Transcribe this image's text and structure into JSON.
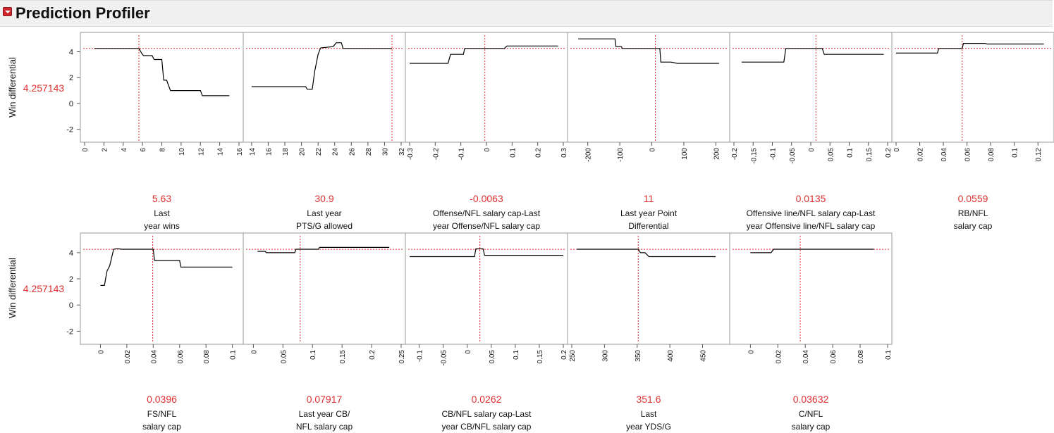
{
  "profiler": {
    "title": "Prediction Profiler",
    "response_label": "Win differential",
    "response_value": "4.257143",
    "colors": {
      "curve": "#000000",
      "crosshair": "#e03030",
      "value_text": "#e03030",
      "frame": "#999999"
    }
  },
  "chart_data": [
    {
      "type": "line",
      "title": "",
      "ylabel": "Win differential",
      "xlabel": "Last year wins",
      "current_x": "5.63",
      "current_x_num": 5.63,
      "current_y": 4.257143,
      "xlim": [
        0,
        16
      ],
      "ylim": [
        -3,
        5.5
      ],
      "xticks": [
        0,
        2,
        4,
        6,
        8,
        10,
        12,
        14,
        16
      ],
      "xtick_labels": [
        "0",
        "2",
        "4",
        "6",
        "8",
        "10",
        "12",
        "14",
        "16"
      ],
      "yticks": [
        -2,
        0,
        2,
        4
      ],
      "ytick_labels": [
        "-2",
        "0",
        "2",
        "4"
      ],
      "x": [
        1,
        5.63,
        5.9,
        6.1,
        7,
        7.2,
        8,
        8.2,
        8.5,
        8.9,
        9.2,
        12,
        12.2,
        15
      ],
      "y": [
        4.26,
        4.26,
        3.9,
        3.7,
        3.7,
        3.4,
        3.4,
        1.8,
        1.8,
        1.0,
        1.0,
        1.0,
        0.6,
        0.6
      ]
    },
    {
      "type": "line",
      "title": "",
      "ylabel": "Win differential",
      "xlabel": "Last year PTS/G allowed",
      "current_x": "30.9",
      "current_x_num": 30.9,
      "current_y": 4.257143,
      "xlim": [
        13.5,
        32
      ],
      "ylim": [
        -3,
        5.5
      ],
      "xticks": [
        14,
        16,
        18,
        20,
        22,
        24,
        26,
        28,
        30,
        32
      ],
      "xtick_labels": [
        "14",
        "16",
        "18",
        "20",
        "22",
        "24",
        "26",
        "28",
        "30",
        "32"
      ],
      "yticks": [
        -2,
        0,
        2,
        4
      ],
      "ytick_labels": [
        "-2",
        "0",
        "2",
        "4"
      ],
      "x": [
        14,
        20.5,
        20.7,
        21.3,
        21.6,
        22,
        22.3,
        23.8,
        24.2,
        24.8,
        25,
        30.9
      ],
      "y": [
        1.3,
        1.3,
        1.1,
        1.1,
        2.5,
        3.8,
        4.3,
        4.4,
        4.7,
        4.7,
        4.26,
        4.26
      ]
    },
    {
      "type": "line",
      "title": "",
      "ylabel": "Win differential",
      "xlabel": "Offense/NFL salary cap-Last year Offense/NFL salary cap",
      "current_x": "-0.0063",
      "current_x_num": -0.0063,
      "current_y": 4.257143,
      "xlim": [
        -0.3,
        0.3
      ],
      "ylim": [
        -3,
        5.5
      ],
      "xticks": [
        -0.3,
        -0.2,
        -0.1,
        0,
        0.1,
        0.2,
        0.3
      ],
      "xtick_labels": [
        "-0.3",
        "-0.2",
        "-0.1",
        "0",
        "0.1",
        "0.2",
        "0.3"
      ],
      "yticks": [
        -2,
        0,
        2,
        4
      ],
      "ytick_labels": [
        "-2",
        "0",
        "2",
        "4"
      ],
      "x": [
        -0.3,
        -0.15,
        -0.14,
        -0.09,
        -0.085,
        0.07,
        0.08,
        0.28
      ],
      "y": [
        3.1,
        3.1,
        3.8,
        3.8,
        4.26,
        4.26,
        4.45,
        4.45
      ]
    },
    {
      "type": "line",
      "title": "",
      "ylabel": "Win differential",
      "xlabel": "Last year Point Differential",
      "current_x": "11",
      "current_x_num": 11,
      "current_y": 4.257143,
      "xlim": [
        -250,
        230
      ],
      "ylim": [
        -3,
        5.5
      ],
      "xticks": [
        -200,
        -100,
        0,
        100,
        200
      ],
      "xtick_labels": [
        "-200",
        "-100",
        "0",
        "100",
        "200"
      ],
      "yticks": [
        -2,
        0,
        2,
        4
      ],
      "ytick_labels": [
        "-2",
        "0",
        "2",
        "4"
      ],
      "x": [
        -230,
        -115,
        -112,
        -95,
        -92,
        11,
        25,
        28,
        60,
        80,
        85,
        100,
        210
      ],
      "y": [
        5.0,
        5.0,
        4.4,
        4.4,
        4.26,
        4.26,
        4.26,
        3.2,
        3.2,
        3.1,
        3.1,
        3.1,
        3.1
      ]
    },
    {
      "type": "line",
      "title": "",
      "ylabel": "Win differential",
      "xlabel": "Offensive line/NFL salary cap-Last year Offensive line/NFL salary cap",
      "current_x": "0.0135",
      "current_x_num": 0.0135,
      "current_y": 4.257143,
      "xlim": [
        -0.2,
        0.2
      ],
      "ylim": [
        -3,
        5.5
      ],
      "xticks": [
        -0.2,
        -0.15,
        -0.1,
        -0.05,
        0,
        0.05,
        0.1,
        0.15,
        0.2
      ],
      "xtick_labels": [
        "-0.2",
        "-0.15",
        "-0.1",
        "-0.05",
        "0",
        "0.05",
        "0.1",
        "0.15",
        "0.2"
      ],
      "yticks": [
        -2,
        0,
        2,
        4
      ],
      "ytick_labels": [
        "-2",
        "0",
        "2",
        "4"
      ],
      "x": [
        -0.18,
        -0.07,
        -0.065,
        0.0135,
        0.03,
        0.035,
        0.19
      ],
      "y": [
        3.2,
        3.2,
        4.26,
        4.26,
        4.26,
        3.8,
        3.8
      ]
    },
    {
      "type": "line",
      "title": "",
      "ylabel": "Win differential",
      "xlabel": "RB/NFL salary cap",
      "current_x": "0.0559",
      "current_x_num": 0.0559,
      "current_y": 4.257143,
      "xlim": [
        0,
        0.13
      ],
      "ylim": [
        -3,
        5.5
      ],
      "xticks": [
        0,
        0.02,
        0.04,
        0.06,
        0.08,
        0.1,
        0.12
      ],
      "xtick_labels": [
        "0",
        "0.02",
        "0.04",
        "0.06",
        "0.08",
        "0.1",
        "0.12"
      ],
      "yticks": [
        -2,
        0,
        2,
        4
      ],
      "ytick_labels": [
        "-2",
        "0",
        "2",
        "4"
      ],
      "x": [
        0,
        0.035,
        0.036,
        0.045,
        0.047,
        0.0559,
        0.057,
        0.075,
        0.077,
        0.125
      ],
      "y": [
        3.9,
        3.9,
        4.26,
        4.26,
        4.26,
        4.26,
        4.65,
        4.65,
        4.6,
        4.6
      ]
    },
    {
      "type": "line",
      "title": "",
      "ylabel": "Win differential",
      "xlabel": "FS/NFL salary cap",
      "current_x": "0.0396",
      "current_x_num": 0.0396,
      "current_y": 4.257143,
      "xlim": [
        -0.012,
        0.105
      ],
      "ylim": [
        -3,
        5.5
      ],
      "xticks": [
        0,
        0.02,
        0.04,
        0.06,
        0.08,
        0.1
      ],
      "xtick_labels": [
        "0",
        "0.02",
        "0.04",
        "0.06",
        "0.08",
        "0.1"
      ],
      "yticks": [
        -2,
        0,
        2,
        4
      ],
      "ytick_labels": [
        "-2",
        "0",
        "2",
        "4"
      ],
      "x": [
        0,
        0.003,
        0.005,
        0.007,
        0.01,
        0.012,
        0.014,
        0.016,
        0.04,
        0.041,
        0.06,
        0.061,
        0.1
      ],
      "y": [
        1.5,
        1.5,
        2.6,
        3.0,
        4.26,
        4.3,
        4.3,
        4.26,
        4.26,
        3.4,
        3.4,
        2.9,
        2.9
      ]
    },
    {
      "type": "line",
      "title": "",
      "ylabel": "Win differential",
      "xlabel": "Last year CB/NFL salary cap",
      "current_x": "0.07917",
      "current_x_num": 0.07917,
      "current_y": 4.257143,
      "xlim": [
        -0.01,
        0.25
      ],
      "ylim": [
        -3,
        5.5
      ],
      "xticks": [
        0,
        0.05,
        0.1,
        0.15,
        0.2,
        0.25
      ],
      "xtick_labels": [
        "0",
        "0.05",
        "0.1",
        "0.15",
        "0.2",
        "0.25"
      ],
      "yticks": [
        -2,
        0,
        2,
        4
      ],
      "ytick_labels": [
        "-2",
        "0",
        "2",
        "4"
      ],
      "x": [
        0.007,
        0.02,
        0.022,
        0.07,
        0.072,
        0.11,
        0.112,
        0.23
      ],
      "y": [
        4.1,
        4.1,
        4.0,
        4.0,
        4.26,
        4.26,
        4.4,
        4.4
      ]
    },
    {
      "type": "line",
      "title": "",
      "ylabel": "Win differential",
      "xlabel": "CB/NFL salary cap-Last year CB/NFL salary cap",
      "current_x": "0.0262",
      "current_x_num": 0.0262,
      "current_y": 4.257143,
      "xlim": [
        -0.12,
        0.2
      ],
      "ylim": [
        -3,
        5.5
      ],
      "xticks": [
        -0.1,
        -0.05,
        0,
        0.05,
        0.1,
        0.15,
        0.2
      ],
      "xtick_labels": [
        "-0.1",
        "-0.05",
        "0",
        "0.05",
        "0.1",
        "0.15",
        "0.2"
      ],
      "yticks": [
        -2,
        0,
        2,
        4
      ],
      "ytick_labels": [
        "-2",
        "0",
        "2",
        "4"
      ],
      "x": [
        -0.12,
        0.015,
        0.018,
        0.033,
        0.036,
        0.2
      ],
      "y": [
        3.7,
        3.7,
        4.3,
        4.3,
        3.8,
        3.8
      ]
    },
    {
      "type": "line",
      "title": "",
      "ylabel": "Win differential",
      "xlabel": "Last year YDS/G",
      "current_x": "351.6",
      "current_x_num": 351.6,
      "current_y": 4.257143,
      "xlim": [
        250,
        485
      ],
      "ylim": [
        -3,
        5.5
      ],
      "xticks": [
        250,
        300,
        350,
        400,
        450
      ],
      "xtick_labels": [
        "250",
        "300",
        "350",
        "400",
        "450"
      ],
      "yticks": [
        -2,
        0,
        2,
        4
      ],
      "ytick_labels": [
        "-2",
        "0",
        "2",
        "4"
      ],
      "x": [
        258,
        351.6,
        355,
        360,
        362,
        368,
        372,
        470
      ],
      "y": [
        4.26,
        4.26,
        4.0,
        4.0,
        4.0,
        3.7,
        3.7,
        3.7
      ]
    },
    {
      "type": "line",
      "title": "",
      "ylabel": "Win differential",
      "xlabel": "C/NFL salary cap",
      "current_x": "0.03632",
      "current_x_num": 0.03632,
      "current_y": 4.257143,
      "xlim": [
        -0.012,
        0.1
      ],
      "ylim": [
        -3,
        5.5
      ],
      "xticks": [
        0,
        0.02,
        0.04,
        0.06,
        0.08,
        0.1
      ],
      "xtick_labels": [
        "0",
        "0.02",
        "0.04",
        "0.06",
        "0.08",
        "0.1"
      ],
      "yticks": [
        -2,
        0,
        2,
        4
      ],
      "ytick_labels": [
        "-2",
        "0",
        "2",
        "4"
      ],
      "x": [
        0,
        0.015,
        0.017,
        0.09
      ],
      "y": [
        4.0,
        4.0,
        4.26,
        4.26
      ]
    }
  ],
  "factor_labels": [
    [
      "Last",
      "year wins"
    ],
    [
      "Last year",
      "PTS/G allowed"
    ],
    [
      "Offense/NFL salary cap-Last",
      "year Offense/NFL salary cap"
    ],
    [
      "Last year Point",
      "Differential"
    ],
    [
      "Offensive line/NFL salary cap-Last",
      "year Offensive line/NFL salary cap"
    ],
    [
      "RB/NFL",
      "salary cap"
    ],
    [
      "FS/NFL",
      "salary cap"
    ],
    [
      "Last year CB/",
      "NFL salary cap"
    ],
    [
      "CB/NFL salary cap-Last",
      "year CB/NFL salary cap"
    ],
    [
      "Last",
      "year YDS/G"
    ],
    [
      "C/NFL",
      "salary cap"
    ]
  ]
}
